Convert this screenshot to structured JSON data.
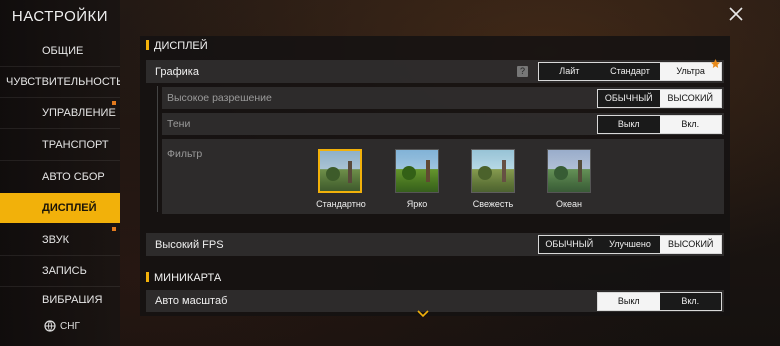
{
  "sidebar": {
    "title": "НАСТРОЙКИ",
    "items": [
      {
        "label": "ОБЩИЕ",
        "active": false,
        "dot": false
      },
      {
        "label": "ЧУВСТВИТЕЛЬНОСТЬ",
        "active": false,
        "dot": false
      },
      {
        "label": "УПРАВЛЕНИЕ",
        "active": false,
        "dot": true
      },
      {
        "label": "ТРАНСПОРТ",
        "active": false,
        "dot": false
      },
      {
        "label": "АВТО СБОР",
        "active": false,
        "dot": false
      },
      {
        "label": "ДИСПЛЕЙ",
        "active": true,
        "dot": false
      },
      {
        "label": "ЗВУК",
        "active": false,
        "dot": true
      },
      {
        "label": "ЗАПИСЬ",
        "active": false,
        "dot": false
      },
      {
        "label": "ВИБРАЦИЯ",
        "active": false,
        "dot": false
      }
    ],
    "region": "СНГ"
  },
  "display": {
    "header": "ДИСПЛЕЙ",
    "graphics": {
      "label": "Графика",
      "help": "?",
      "options": [
        "Лайт",
        "Стандарт",
        "Ультра"
      ],
      "selected": "Ультра"
    },
    "high_res": {
      "label": "Высокое разрешение",
      "options": [
        "ОБЫЧНЫЙ",
        "ВЫСОКИЙ"
      ],
      "selected": "ВЫСОКИЙ"
    },
    "shadows": {
      "label": "Тени",
      "options": [
        "Выкл",
        "Вкл."
      ],
      "selected": "Вкл."
    },
    "filter": {
      "label": "Фильтр",
      "options": [
        "Стандартно",
        "Ярко",
        "Свежесть",
        "Океан"
      ],
      "selected": "Стандартно"
    },
    "high_fps": {
      "label": "Высокий FPS",
      "options": [
        "ОБЫЧНЫЙ",
        "Улучшено",
        "ВЫСОКИЙ"
      ],
      "selected": "ВЫСОКИЙ"
    }
  },
  "minimap": {
    "header": "МИНИКАРТА",
    "auto_scale": {
      "label": "Авто масштаб",
      "options": [
        "Выкл",
        "Вкл."
      ],
      "selected": "Выкл"
    }
  },
  "colors": {
    "accent": "#f2b10a",
    "dot": "#e27a1e"
  }
}
